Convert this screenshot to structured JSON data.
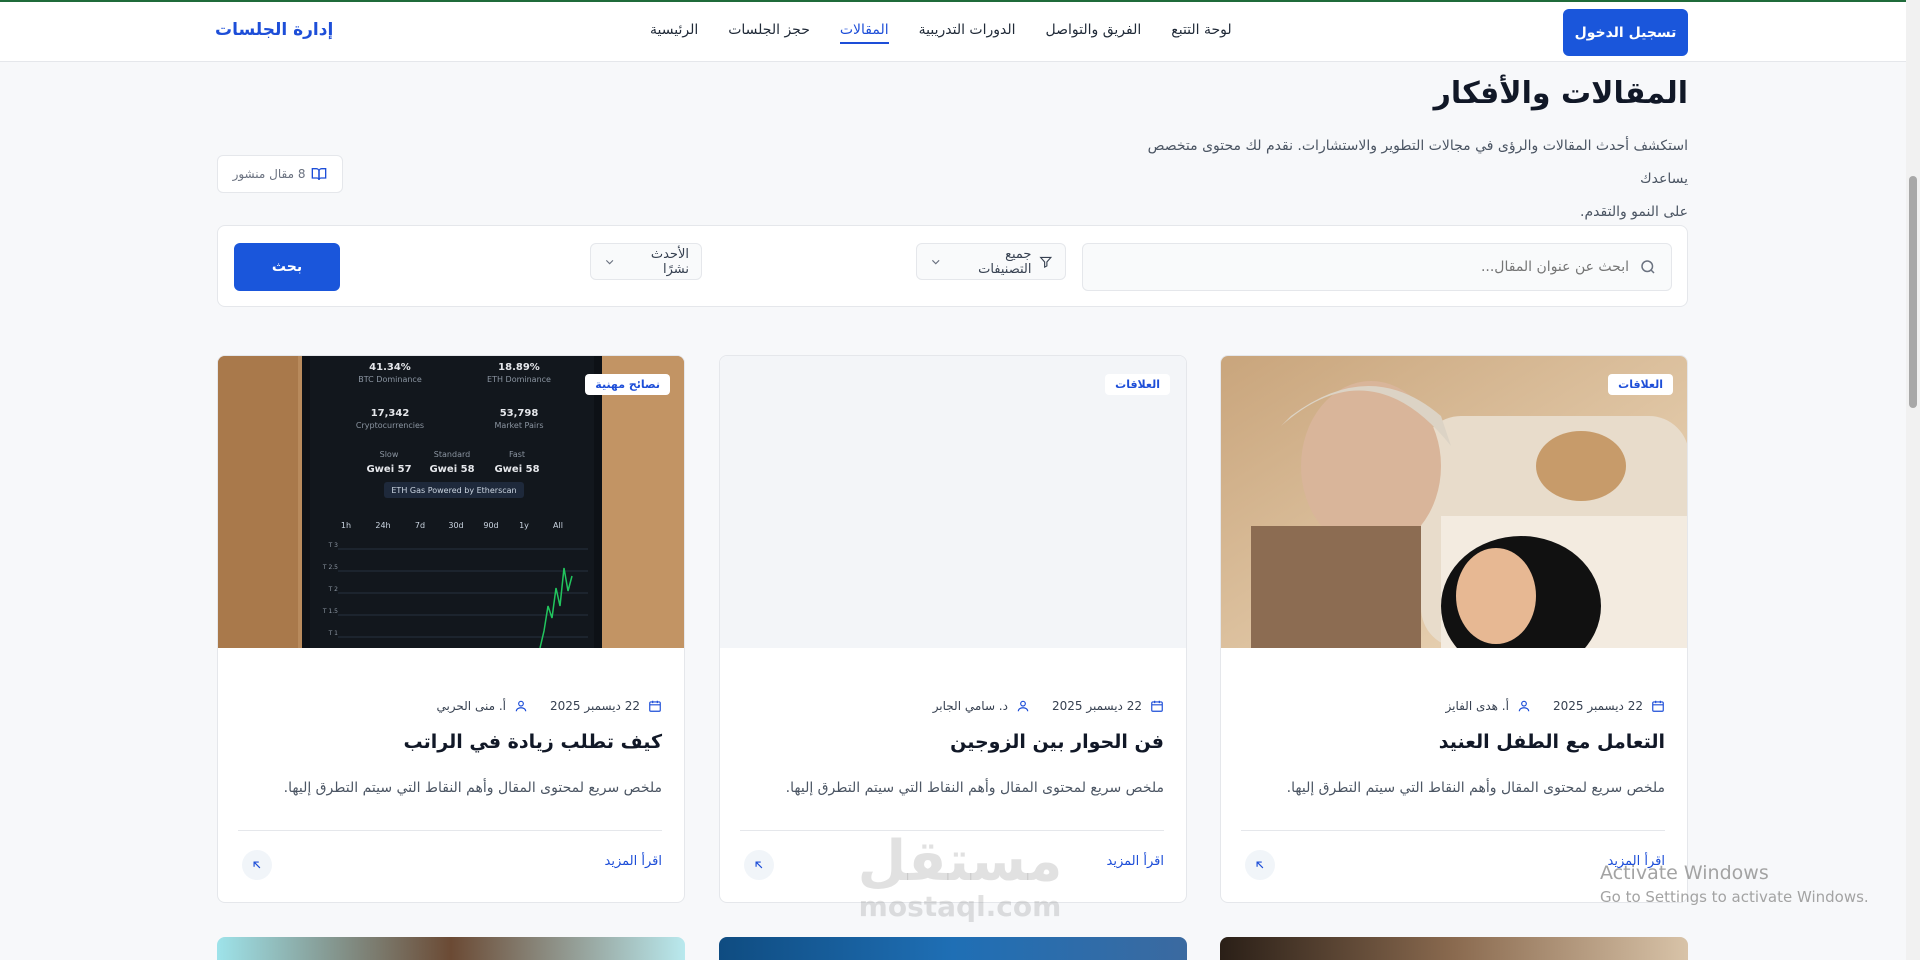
{
  "nav": {
    "brand": "إدارة الجلسات",
    "links": [
      "الرئيسية",
      "حجز الجلسات",
      "المقالات",
      "الدورات التدريبية",
      "الفريق والتواصل",
      "لوحة التتبع"
    ],
    "active_link": "المقالات",
    "login_label": "تسجيل الدخول"
  },
  "header": {
    "title": "المقالات والأفكار",
    "description_line1": "استكشف أحدث المقالات والرؤى في مجالات التطوير والاستشارات. نقدم لك محتوى متخصص يساعدك",
    "description_line2": "على النمو والتقدم.",
    "count_label": "8 مقال منشور"
  },
  "filters": {
    "search_placeholder": "ابحث عن عنوان المقال...",
    "category_label": "جميع التصنيفات",
    "sort_label": "الأحدث نشرًا",
    "search_button": "بحث"
  },
  "articles": [
    {
      "tag": "العلاقات",
      "date": "22 ديسمبر 2025",
      "author": "أ. هدى الفايز",
      "title": "التعامل مع الطفل العنيد",
      "excerpt": "ملخص سريع لمحتوى المقال وأهم النقاط التي سيتم التطرق إليها.",
      "read_more": "اقرأ المزيد"
    },
    {
      "tag": "العلاقات",
      "date": "22 ديسمبر 2025",
      "author": "د. سامي الجابر",
      "title": "فن الحوار بين الزوجين",
      "excerpt": "ملخص سريع لمحتوى المقال وأهم النقاط التي سيتم التطرق إليها.",
      "read_more": "اقرأ المزيد"
    },
    {
      "tag": "نصائح مهنية",
      "date": "22 ديسمبر 2025",
      "author": "أ. منى الحربي",
      "title": "كيف تطلب زيادة في الراتب",
      "excerpt": "ملخص سريع لمحتوى المقال وأهم النقاط التي سيتم التطرق إليها.",
      "read_more": "اقرأ المزيد"
    }
  ],
  "phone_screen": {
    "stats": [
      {
        "value": "41.34%",
        "label": "BTC Dominance"
      },
      {
        "value": "18.89%",
        "label": "ETH Dominance"
      },
      {
        "value": "17,342",
        "label": "Cryptocurrencies"
      },
      {
        "value": "53,798",
        "label": "Market Pairs"
      }
    ],
    "gas": [
      {
        "label": "Slow",
        "value": "57 Gwei"
      },
      {
        "label": "Standard",
        "value": "58 Gwei"
      },
      {
        "label": "Fast",
        "value": "58 Gwei"
      }
    ],
    "gas_badge": "ETH Gas  Powered by Etherscan",
    "ranges": [
      "1h",
      "24h",
      "7d",
      "30d",
      "90d",
      "1y",
      "All"
    ],
    "y_ticks": [
      "3 T",
      "2.5 T",
      "2 T",
      "1.5 T",
      "1 T"
    ]
  },
  "watermarks": {
    "activate_title": "Activate Windows",
    "activate_sub": "Go to Settings to activate Windows.",
    "logo_ar": "مستقل",
    "logo_en": "mostaql.com"
  },
  "colors": {
    "primary": "#1a56db",
    "link": "#1d4ed8"
  }
}
